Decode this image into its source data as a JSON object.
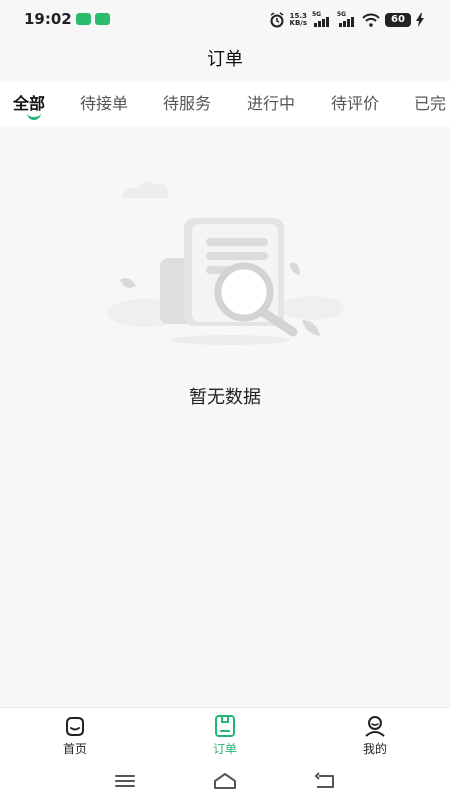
{
  "status_bar": {
    "time": "19:02",
    "net_speed_value": "15.3",
    "net_speed_unit": "KB/s",
    "signal_1_label": "5G",
    "signal_2_label": "5G",
    "battery_level": "60"
  },
  "header": {
    "title": "订单"
  },
  "tabs": [
    {
      "label": "全部",
      "active": true
    },
    {
      "label": "待接单",
      "active": false
    },
    {
      "label": "待服务",
      "active": false
    },
    {
      "label": "进行中",
      "active": false
    },
    {
      "label": "待评价",
      "active": false
    },
    {
      "label": "已完",
      "active": false
    }
  ],
  "empty_state": {
    "message": "暂无数据"
  },
  "bottom_nav": [
    {
      "label": "首页",
      "icon": "home-icon",
      "active": false
    },
    {
      "label": "订单",
      "icon": "order-icon",
      "active": true
    },
    {
      "label": "我的",
      "icon": "profile-icon",
      "active": false
    }
  ],
  "colors": {
    "accent": "#22b573",
    "background": "#f7f7f7"
  }
}
